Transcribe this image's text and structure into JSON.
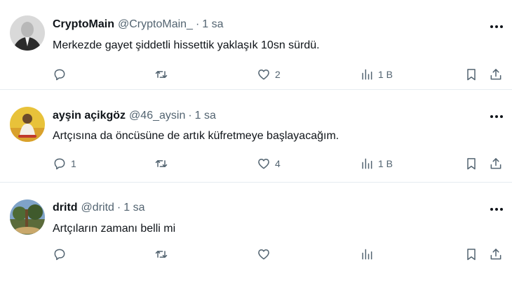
{
  "tweets": [
    {
      "name": "CryptoMain",
      "handle": "@CryptoMain_",
      "dot": "·",
      "time": "1 sa",
      "text": "Merkezde gayet şiddetli hissettik yaklaşık 10sn sürdü.",
      "replies": "",
      "retweets": "",
      "likes": "2",
      "views": "1 B"
    },
    {
      "name": "ayşin açikgöz",
      "handle": "@46_aysin",
      "dot": "·",
      "time": "1 sa",
      "text": "Artçısına da öncüsüne de artık küfretmeye başlayacağım.",
      "replies": "1",
      "retweets": "",
      "likes": "4",
      "views": "1 B"
    },
    {
      "name": "dritd",
      "handle": "@dritd",
      "dot": "·",
      "time": "1 sa",
      "text": "Artçıların zamanı belli mi",
      "replies": "",
      "retweets": "",
      "likes": "",
      "views": ""
    }
  ],
  "icons": {
    "more": "more-dots-icon",
    "reply": "reply-icon",
    "retweet": "retweet-icon",
    "like": "heart-icon",
    "views": "views-bar-chart-icon",
    "bookmark": "bookmark-icon",
    "share": "share-icon"
  },
  "colors": {
    "text": "#0f1419",
    "secondary": "#536471",
    "divider": "#e6ecf0"
  }
}
